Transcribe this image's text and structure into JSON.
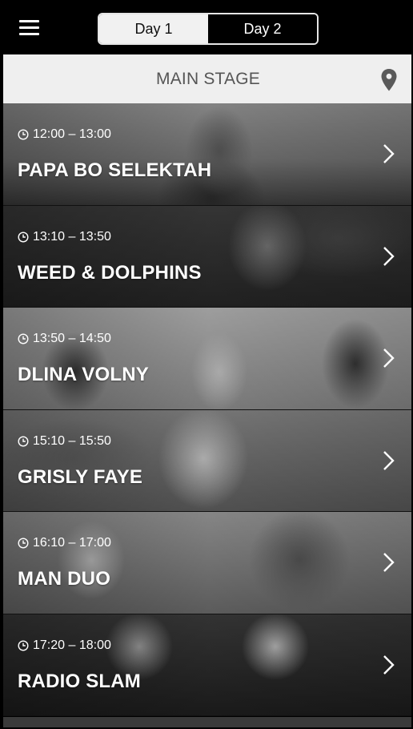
{
  "header": {
    "menu_icon": "hamburger-menu-icon",
    "tabs": [
      {
        "label": "Day 1",
        "active": true
      },
      {
        "label": "Day 2",
        "active": false
      }
    ]
  },
  "stage": {
    "title": "MAIN STAGE",
    "location_icon": "map-pin-icon"
  },
  "schedule": [
    {
      "time": "12:00 – 13:00",
      "artist": "PAPA BO SELEKTAH"
    },
    {
      "time": "13:10 – 13:50",
      "artist": "WEED & DOLPHINS"
    },
    {
      "time": "13:50 – 14:50",
      "artist": "DLINA VOLNY"
    },
    {
      "time": "15:10 – 15:50",
      "artist": "GRISLY FAYE"
    },
    {
      "time": "16:10 – 17:00",
      "artist": "MAN DUO"
    },
    {
      "time": "17:20 – 18:00",
      "artist": "RADIO SLAM"
    }
  ],
  "colors": {
    "topbar_bg": "#000000",
    "active_tab_bg": "#f1f1f1",
    "stage_header_bg": "#efefef",
    "stage_title_color": "#555555",
    "row_text": "#ffffff"
  }
}
